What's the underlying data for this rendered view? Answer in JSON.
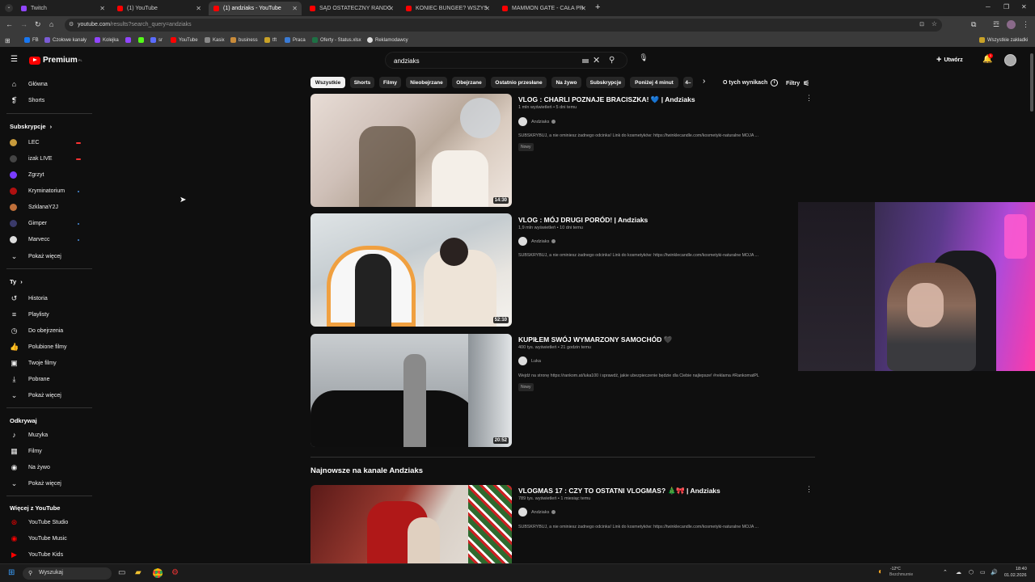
{
  "browser": {
    "tabs": [
      {
        "title": "Twitch",
        "color": "#9146ff",
        "active": false
      },
      {
        "title": "(1) YouTube",
        "color": "#ff0000",
        "active": false
      },
      {
        "title": "(1) andziaks - YouTube",
        "color": "#ff0000",
        "active": true
      },
      {
        "title": "SĄD OSTATECZNY RANDOMBI",
        "color": "#ff0000",
        "active": false
      },
      {
        "title": "KONIEC BUNGEE? WSZYSCY W",
        "color": "#ff0000",
        "active": false
      },
      {
        "title": "MAMMON GATE - CAŁA PRAW",
        "color": "#ff0000",
        "active": false
      }
    ],
    "new_tab": "+",
    "url_host": "youtube.com",
    "url_path": "/results?search_query=andziaks",
    "bookmarks": [
      {
        "label": "FB",
        "color": "#1877f2"
      },
      {
        "label": "Czołowe kanały",
        "color": "#7b5cd6"
      },
      {
        "label": "Kolejka",
        "color": "#9146ff"
      },
      {
        "label": "",
        "color": "#9146ff"
      },
      {
        "label": "",
        "color": "#53fc18"
      },
      {
        "label": "sr",
        "color": "#5a6cff"
      },
      {
        "label": "YouTube",
        "color": "#ff0000"
      },
      {
        "label": "Kasix",
        "color": "#888"
      },
      {
        "label": "business",
        "color": "#c98b3a"
      },
      {
        "label": "tft",
        "color": "#c9a227"
      },
      {
        "label": "Praca",
        "color": "#3a7bd5"
      },
      {
        "label": "Oferty - Status.xlsx",
        "color": "#1e7145"
      },
      {
        "label": "Reklamodawcy",
        "color": "#ddd"
      }
    ],
    "all_bookmarks": "Wszystkie zakładki"
  },
  "header": {
    "logo_text": "Premium",
    "logo_region": "PL",
    "search_value": "andziaks",
    "create_label": "Utwórz",
    "bell_count": "1"
  },
  "sidebar": {
    "main": [
      {
        "label": "Główna",
        "icon": "home-icon"
      },
      {
        "label": "Shorts",
        "icon": "shorts-icon"
      }
    ],
    "subs_title": "Subskrypcje",
    "subs": [
      {
        "label": "LEC",
        "color": "#c89b3c",
        "status": "live"
      },
      {
        "label": "izak LIVE",
        "color": "#444",
        "status": "live"
      },
      {
        "label": "Zgrzyt",
        "color": "#7a3cff",
        "status": ""
      },
      {
        "label": "Kryminatorium",
        "color": "#b01010",
        "status": "dot"
      },
      {
        "label": "SzklanaY2J",
        "color": "#c0703a",
        "status": ""
      },
      {
        "label": "Gimper",
        "color": "#3a3a6a",
        "status": "dot"
      },
      {
        "label": "Marvecc",
        "color": "#dddddd",
        "status": "dot"
      }
    ],
    "show_more": "Pokaż więcej",
    "you_title": "Ty",
    "you": [
      {
        "label": "Historia",
        "icon": "history-icon"
      },
      {
        "label": "Playlisty",
        "icon": "playlist-icon"
      },
      {
        "label": "Do obejrzenia",
        "icon": "watch-later-icon"
      },
      {
        "label": "Polubione filmy",
        "icon": "like-icon"
      },
      {
        "label": "Twoje filmy",
        "icon": "your-videos-icon"
      },
      {
        "label": "Pobrane",
        "icon": "download-icon"
      }
    ],
    "explore_title": "Odkrywaj",
    "explore": [
      {
        "label": "Muzyka",
        "icon": "music-icon"
      },
      {
        "label": "Filmy",
        "icon": "film-icon"
      },
      {
        "label": "Na żywo",
        "icon": "live-icon"
      }
    ],
    "more_title": "Więcej z YouTube",
    "more": [
      {
        "label": "YouTube Studio"
      },
      {
        "label": "YouTube Music"
      },
      {
        "label": "YouTube Kids"
      }
    ]
  },
  "chips": [
    "Wszystkie",
    "Shorts",
    "Filmy",
    "Nieobejrzane",
    "Obejrzane",
    "Ostatnio przesłane",
    "Na żywo",
    "Subskrypcje",
    "Poniżej 4 minut",
    "4–"
  ],
  "about_results": "O tych wynikach",
  "filters": "Filtry",
  "videos": [
    {
      "title": "VLOG : CHARLI POZNAJE BRACISZKA! 💙 | Andziaks",
      "meta": "1 mln wyświetleń • 5 dni temu",
      "channel": "Andziaks",
      "desc": "SUBSKRYBUJ, a nie ominiesz żadnego odcinka! Link do kosmetyków: https://twinklecandle.com/kosmetyki-naturalne MOJA ...",
      "badge": "Nowy",
      "duration": "14:30"
    },
    {
      "title": "VLOG : MÓJ DRUGI PORÓD! | Andziaks",
      "meta": "1,9 mln wyświetleń • 10 dni temu",
      "channel": "Andziaks",
      "desc": "SUBSKRYBUJ, a nie ominiesz żadnego odcinka! Link do kosmetyków: https://twinklecandle.com/kosmetyki-naturalne MOJA ...",
      "badge": "",
      "duration": "52:10"
    },
    {
      "title": "KUPIŁEM SWÓJ WYMARZONY SAMOCHÓD 🖤",
      "meta": "400 tys. wyświetleń • 21 godzin temu",
      "channel": "Luka",
      "desc": "Wejdź na stronę https://rankom.at/luka100 i sprawdź, jakie ubezpieczenie będzie dla Ciebie najlepsze! #reklama #RankomatPL",
      "badge": "Nowy",
      "duration": "20:52"
    }
  ],
  "section_title": "Najnowsze na kanale Andziaks",
  "latest": {
    "title": "VLOGMAS 17 : CZY TO OSTATNI VLOGMAS? 🎄🎀 | Andziaks",
    "meta": "789 tys. wyświetleń • 1 miesiąc temu",
    "channel": "Andziaks",
    "desc": "SUBSKRYBUJ, a nie ominiesz żadnego odcinka! Link do kosmetyków: https://twinklecandle.com/kosmetyki-naturalne MOJA ..."
  },
  "taskbar": {
    "search_placeholder": "Wyszukaj",
    "weather_temp": "-12°C",
    "weather_desc": "Bezchmurnie",
    "time": "18:40",
    "date": "01.02.2026"
  }
}
